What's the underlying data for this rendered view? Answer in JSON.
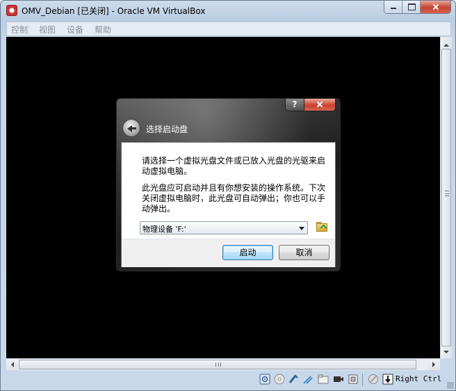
{
  "window": {
    "title": "OMV_Debian [已关闭] - Oracle VM VirtualBox"
  },
  "menu": {
    "items": [
      "控制",
      "视图",
      "设备",
      "帮助"
    ]
  },
  "dialog": {
    "title": "选择启动盘",
    "help_label": "?",
    "paragraph1": "请选择一个虚拟光盘文件或已放入光盘的光驱来启动虚拟电脑。",
    "paragraph2": "此光盘应可启动并且有你想安装的操作系统。下次关闭虚拟电脑时，此光盘可自动弹出；你也可以手动弹出。",
    "media_value": "物理设备 'F:'",
    "start_label": "启动",
    "cancel_label": "取消"
  },
  "statusbar": {
    "host_key": "Right Ctrl",
    "icons": [
      "hard-disk-icon",
      "optical-drive-icon",
      "usb-icon",
      "network-icon",
      "shared-folder-icon",
      "video-capture-icon",
      "cpu-icon",
      "mouse-integration-icon",
      "keyboard-capture-icon"
    ]
  },
  "colors": {
    "vm_screen": "#000000",
    "accent": "#3c7fb1"
  }
}
